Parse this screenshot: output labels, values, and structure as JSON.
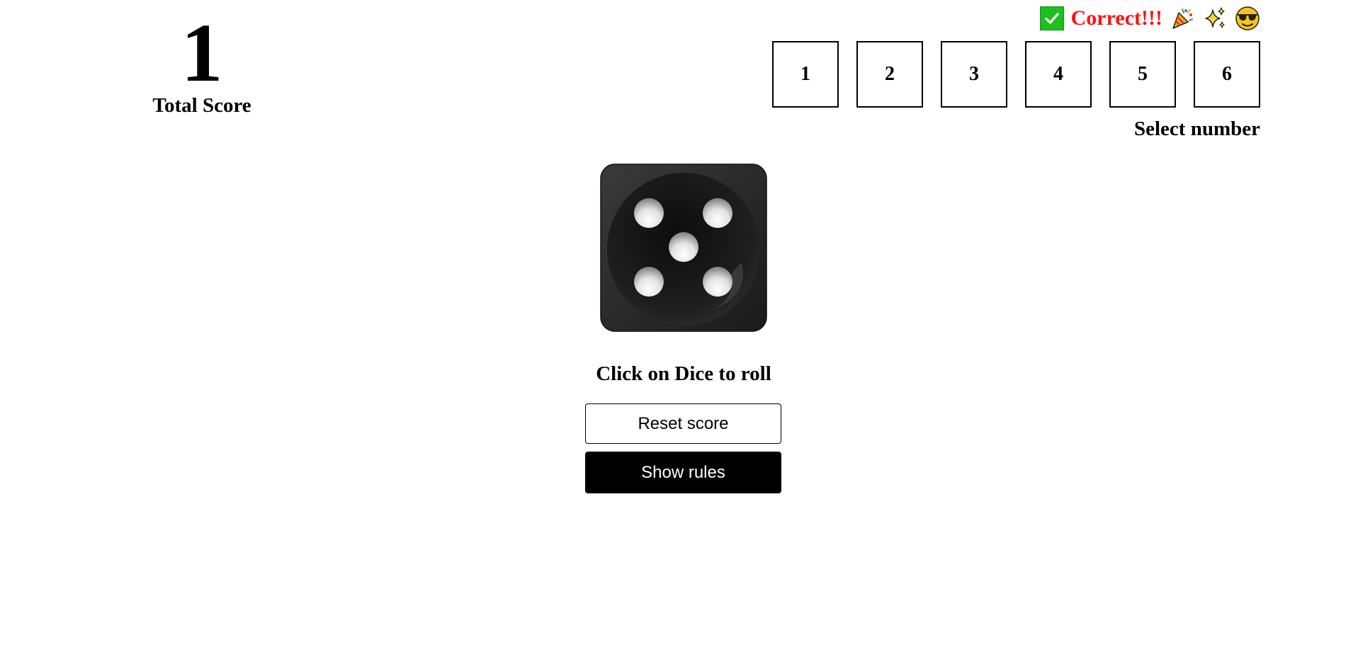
{
  "score": {
    "value": "1",
    "label": "Total Score"
  },
  "feedback": {
    "icon": "check-mark-icon",
    "text": "Correct!!!",
    "text_color": "#ff1010",
    "emojis": [
      "party-popper-icon",
      "sparkles-icon",
      "sunglasses-face-icon"
    ]
  },
  "number_selector": {
    "options": [
      "1",
      "2",
      "3",
      "4",
      "5",
      "6"
    ],
    "label": "Select number"
  },
  "dice": {
    "face_value": 5,
    "icon": "dice-five-icon",
    "color": "#222222"
  },
  "roll_hint": "Click on Dice to roll",
  "buttons": {
    "reset_label": "Reset score",
    "rules_label": "Show rules"
  }
}
